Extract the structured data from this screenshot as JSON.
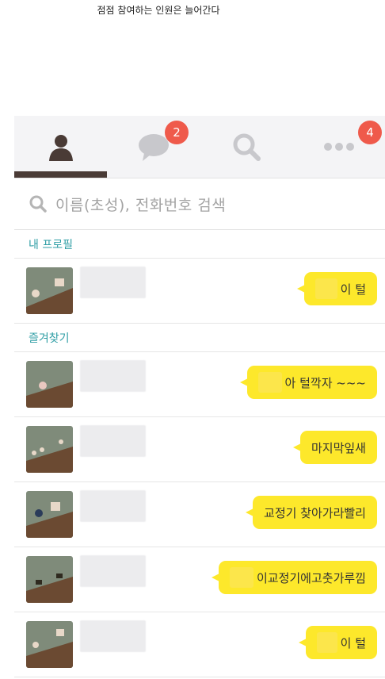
{
  "caption": "점점 참여하는 인원은 늘어간다",
  "colors": {
    "accent_teal": "#2f9ea5",
    "bubble_yellow": "#fde82b",
    "badge_red": "#ef5a4b",
    "tab_active": "#4a3b36"
  },
  "tabs": [
    {
      "icon": "person-icon",
      "badge": ""
    },
    {
      "icon": "chat-bubble-icon",
      "badge": "2"
    },
    {
      "icon": "search-icon",
      "badge": ""
    },
    {
      "icon": "more-icon",
      "badge": "4"
    }
  ],
  "search": {
    "placeholder": "이름(초성), 전화번호 검색"
  },
  "sections": {
    "my_profile": "내 프로필",
    "favorites": "즐겨찾기"
  },
  "profile": {
    "status": "이 털"
  },
  "friends": [
    {
      "status": "아 털깍자 ~~~"
    },
    {
      "status": "마지막잎새"
    },
    {
      "status": "교정기 찾아가라빨리"
    },
    {
      "status": "이교정기에고춧가루낌"
    },
    {
      "status": "이 털"
    }
  ]
}
